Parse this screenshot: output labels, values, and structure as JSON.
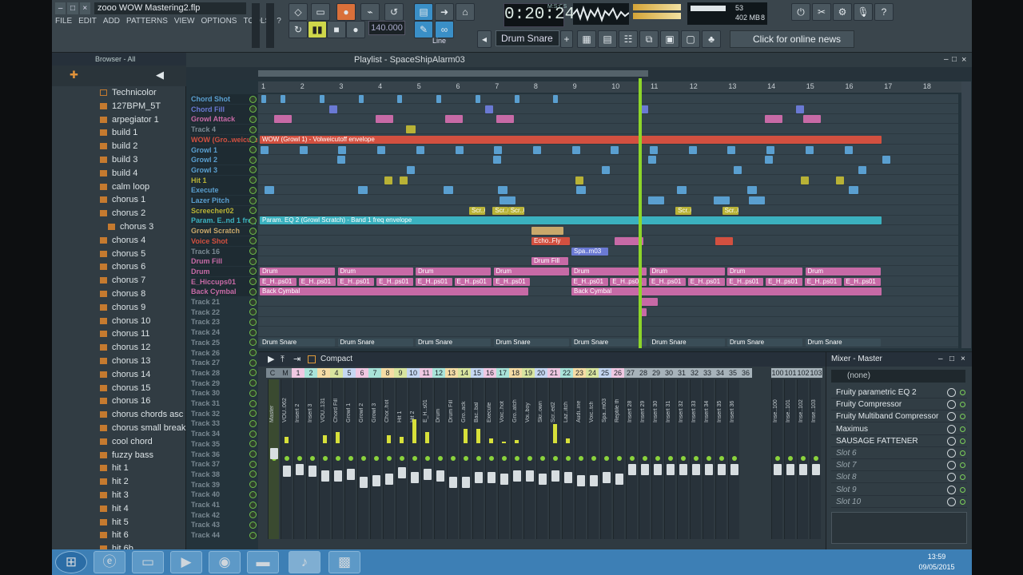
{
  "window": {
    "title": "zooo WOW Mastering2.flp",
    "min": "–",
    "max": "□",
    "close": "×"
  },
  "menu": [
    "FILE",
    "EDIT",
    "ADD",
    "PATTERNS",
    "VIEW",
    "OPTIONS",
    "TOOLS",
    "?"
  ],
  "transport": {
    "time": "0:20:24",
    "tempo": "140.000",
    "pattern": "Drum Snare",
    "snap": "Line",
    "msc": "M:S:CS"
  },
  "cpu": {
    "value": "53",
    "mem": "402 MB",
    "poly": "8"
  },
  "news": "Click for online news",
  "browser": {
    "title": "Browser - All",
    "items": [
      "Technicolor",
      "127BPM_5T",
      "arpegiator 1",
      "build 1",
      "build 2",
      "build 3",
      "build 4",
      "calm loop",
      "chorus 1",
      "chorus 2",
      "chorus 3",
      "chorus 4",
      "chorus 5",
      "chorus 6",
      "chorus 7",
      "chorus 8",
      "chorus 9",
      "chorus 10",
      "chorus 11",
      "chorus 12",
      "chorus 13",
      "chorus 14",
      "chorus 15",
      "chorus 16",
      "chorus chords asc",
      "chorus small break",
      "cool chord",
      "fuzzy bass",
      "hit 1",
      "hit 2",
      "hit 3",
      "hit 4",
      "hit 5",
      "hit 6",
      "hit 6b"
    ]
  },
  "playlist": {
    "title": "Playlist - SpaceShipAlarm03",
    "ruler": [
      "1",
      "2",
      "3",
      "4",
      "5",
      "6",
      "7",
      "8",
      "9",
      "10",
      "11",
      "12",
      "13",
      "14",
      "15",
      "16",
      "17",
      "18"
    ],
    "tracks": [
      {
        "name": "Chord Shot",
        "color": "#5a9fd0"
      },
      {
        "name": "Chord Fill",
        "color": "#6a79d3"
      },
      {
        "name": "Growl Attack",
        "color": "#c76aa6"
      },
      {
        "name": "Track 4",
        "color": "#7b8a93"
      },
      {
        "name": "WOW (Gro..weicutoff",
        "color": "#d25040"
      },
      {
        "name": "Growl 1",
        "color": "#5a9fd0"
      },
      {
        "name": "Growl 2",
        "color": "#5a9fd0"
      },
      {
        "name": "Growl 3",
        "color": "#5a9fd0"
      },
      {
        "name": "Hit 1",
        "color": "#b8b236"
      },
      {
        "name": "Execute",
        "color": "#5a9fd0"
      },
      {
        "name": "Lazer Pitch",
        "color": "#5a9fd0"
      },
      {
        "name": "Screecher02",
        "color": "#b8b236"
      },
      {
        "name": "Param. E..nd 1 freq",
        "color": "#3bb1bf"
      },
      {
        "name": "Growl Scratch",
        "color": "#c9a86b"
      },
      {
        "name": "Voice Shot",
        "color": "#d25040"
      },
      {
        "name": "Track 16",
        "color": "#7b8a93"
      },
      {
        "name": "Drum Fill",
        "color": "#c76aa6"
      },
      {
        "name": "Drum",
        "color": "#c76aa6"
      },
      {
        "name": "E_Hiccups01",
        "color": "#c76aa6"
      },
      {
        "name": "Back Cymbal",
        "color": "#c76aa6"
      },
      {
        "name": "Track 21",
        "color": "#7b8a93"
      },
      {
        "name": "Track 22",
        "color": "#7b8a93"
      },
      {
        "name": "Track 23",
        "color": "#7b8a93"
      },
      {
        "name": "Track 24",
        "color": "#7b8a93"
      },
      {
        "name": "Track 25",
        "color": "#7b8a93"
      },
      {
        "name": "Track 26",
        "color": "#7b8a93"
      },
      {
        "name": "Track 27",
        "color": "#7b8a93"
      },
      {
        "name": "Track 28",
        "color": "#7b8a93"
      },
      {
        "name": "Track 29",
        "color": "#7b8a93"
      },
      {
        "name": "Track 30",
        "color": "#7b8a93"
      },
      {
        "name": "Track 31",
        "color": "#7b8a93"
      },
      {
        "name": "Track 32",
        "color": "#7b8a93"
      },
      {
        "name": "Track 33",
        "color": "#7b8a93"
      },
      {
        "name": "Track 34",
        "color": "#7b8a93"
      },
      {
        "name": "Track 35",
        "color": "#7b8a93"
      },
      {
        "name": "Track 36",
        "color": "#7b8a93"
      },
      {
        "name": "Track 37",
        "color": "#7b8a93"
      },
      {
        "name": "Track 38",
        "color": "#7b8a93"
      },
      {
        "name": "Track 39",
        "color": "#7b8a93"
      },
      {
        "name": "Track 40",
        "color": "#7b8a93"
      },
      {
        "name": "Track 41",
        "color": "#7b8a93"
      },
      {
        "name": "Track 42",
        "color": "#7b8a93"
      },
      {
        "name": "Track 43",
        "color": "#7b8a93"
      },
      {
        "name": "Track 44",
        "color": "#7b8a93"
      }
    ],
    "clips": {
      "wow": "WOW (Growl 1) - Volweicutoff envelope",
      "param": "Param. EQ 2 (Growl Scratch) - Band 1 freq envelope",
      "drum": "Drum",
      "hiccup": "E_H..ps01",
      "cymbal": "Back Cymbal",
      "drumsnare": "Drum Snare",
      "echo": "Echo..Fly",
      "drumfill": "Drum Fill",
      "screech": "Scr..02",
      "spa": "Spa..m03"
    }
  },
  "mixer": {
    "title": "Compact",
    "master_title": "Mixer - Master",
    "none": "(none)",
    "channels": [
      "Master",
      "VOU..062",
      "Insert 2",
      "Insert 3",
      "VOU..131",
      "Chord Fill",
      "Growl 1",
      "Growl 2",
      "Growl 3",
      "Chor..hot",
      "Hit 1",
      "Hit 2",
      "E_H..s01",
      "Drum",
      "Drum Fill",
      "Gro..ack",
      "Bac..bal",
      "Execute",
      "Voic..hot",
      "Gro..atch",
      "Voi..boy",
      "Skr..own",
      "Scr..ed2",
      "Laz..itch",
      "Audi..ine",
      "Voic..tch",
      "Spa..m03",
      "Reptile th",
      "Insert 28",
      "Insert 29",
      "Insert 30",
      "Insert 31",
      "Insert 32",
      "Insert 33",
      "Insert 34",
      "Insert 35",
      "Insert 36"
    ],
    "numbers": [
      "C",
      "M",
      "1",
      "2",
      "3",
      "4",
      "5",
      "6",
      "7",
      "8",
      "9",
      "10",
      "11",
      "12",
      "13",
      "14",
      "15",
      "16",
      "17",
      "18",
      "19",
      "20",
      "21",
      "22",
      "23",
      "24",
      "25",
      "26",
      "27",
      "28",
      "29",
      "30",
      "31",
      "32",
      "33",
      "34",
      "35",
      "36",
      "100",
      "101",
      "102",
      "103"
    ],
    "slots": [
      "Fruity parametric EQ 2",
      "Fruity Compressor",
      "Fruity Multiband Compressor",
      "Maximus",
      "SAUSAGE FATTENER",
      "Slot 6",
      "Slot 7",
      "Slot 8",
      "Slot 9",
      "Slot 10"
    ],
    "last": [
      "Inse..100",
      "Inse..101",
      "Inse..102",
      "Inse..103"
    ]
  },
  "taskbar": {
    "time": "13:59",
    "date": "09/05/2015"
  }
}
